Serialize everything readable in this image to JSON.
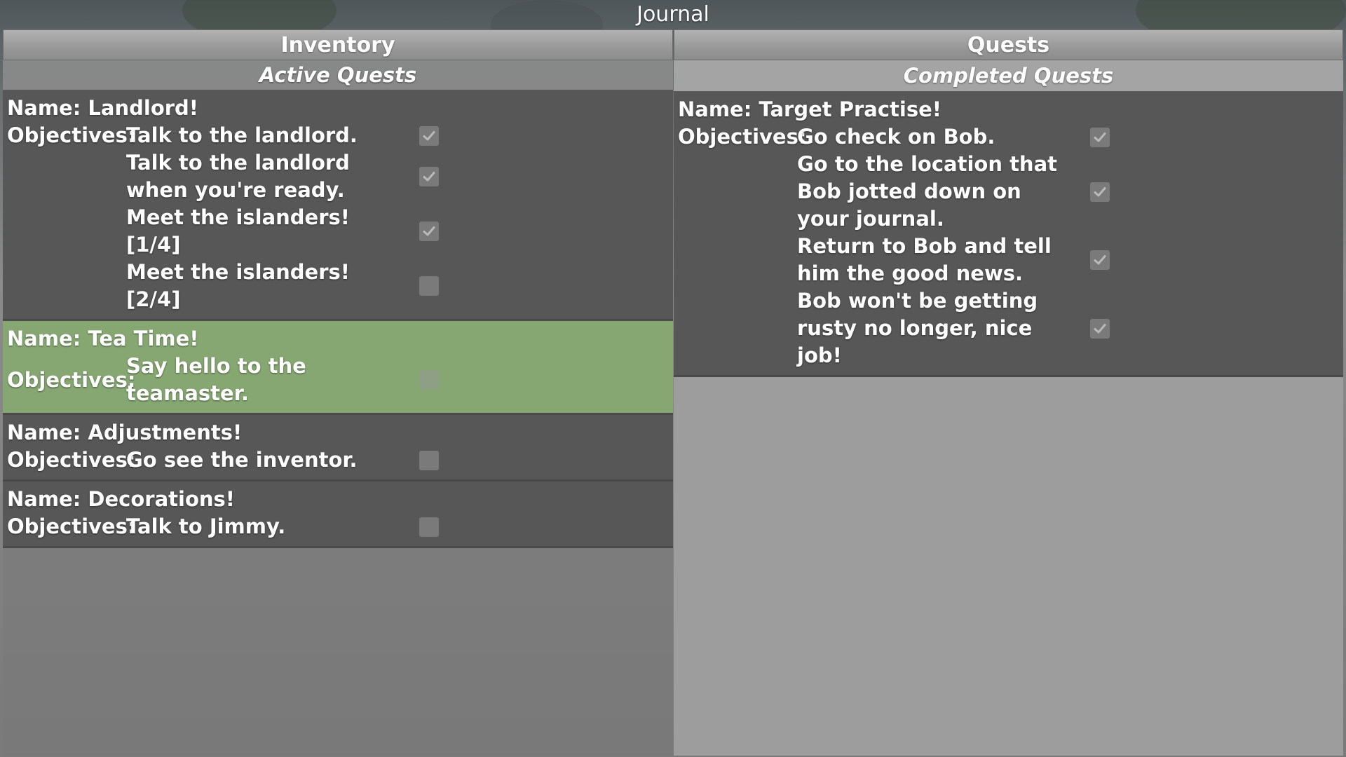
{
  "window": {
    "title": "Journal"
  },
  "tabs": [
    {
      "label": "Inventory"
    },
    {
      "label": "Quests"
    }
  ],
  "active_quests": {
    "header": "Active Quests",
    "items": [
      {
        "name": "Name: Landlord!",
        "objectives_label": "Objectives:",
        "selected": false,
        "objectives": [
          {
            "text": "Talk to the landlord.",
            "done": true
          },
          {
            "text": "Talk to the landlord when you're ready.",
            "done": true
          },
          {
            "text": "Meet the islanders! [1/4]",
            "done": true
          },
          {
            "text": "Meet the islanders! [2/4]",
            "done": false
          }
        ]
      },
      {
        "name": "Name: Tea Time!",
        "objectives_label": "Objectives:",
        "selected": true,
        "objectives": [
          {
            "text": "Say hello to the teamaster.",
            "done": false
          }
        ]
      },
      {
        "name": "Name: Adjustments!",
        "objectives_label": "Objectives:",
        "selected": false,
        "objectives": [
          {
            "text": "Go see the inventor.",
            "done": false
          }
        ]
      },
      {
        "name": "Name: Decorations!",
        "objectives_label": "Objectives:",
        "selected": false,
        "objectives": [
          {
            "text": "Talk to Jimmy.",
            "done": false
          }
        ]
      }
    ]
  },
  "completed_quests": {
    "header": "Completed Quests",
    "items": [
      {
        "name": "Name: Target Practise!",
        "objectives_label": "Objectives:",
        "selected": false,
        "objectives": [
          {
            "text": "Go check on Bob.",
            "done": true
          },
          {
            "text": "Go to the location that Bob jotted down on your journal.",
            "done": true
          },
          {
            "text": "Return to Bob and tell him the good news.",
            "done": true
          },
          {
            "text": "Bob won't be getting rusty no longer, nice job!",
            "done": true
          }
        ]
      }
    ]
  },
  "colors": {
    "selected_quest_bg": "#86a772",
    "quest_card_bg": "#575757",
    "checkbox_bg": "#7a7a7a"
  }
}
